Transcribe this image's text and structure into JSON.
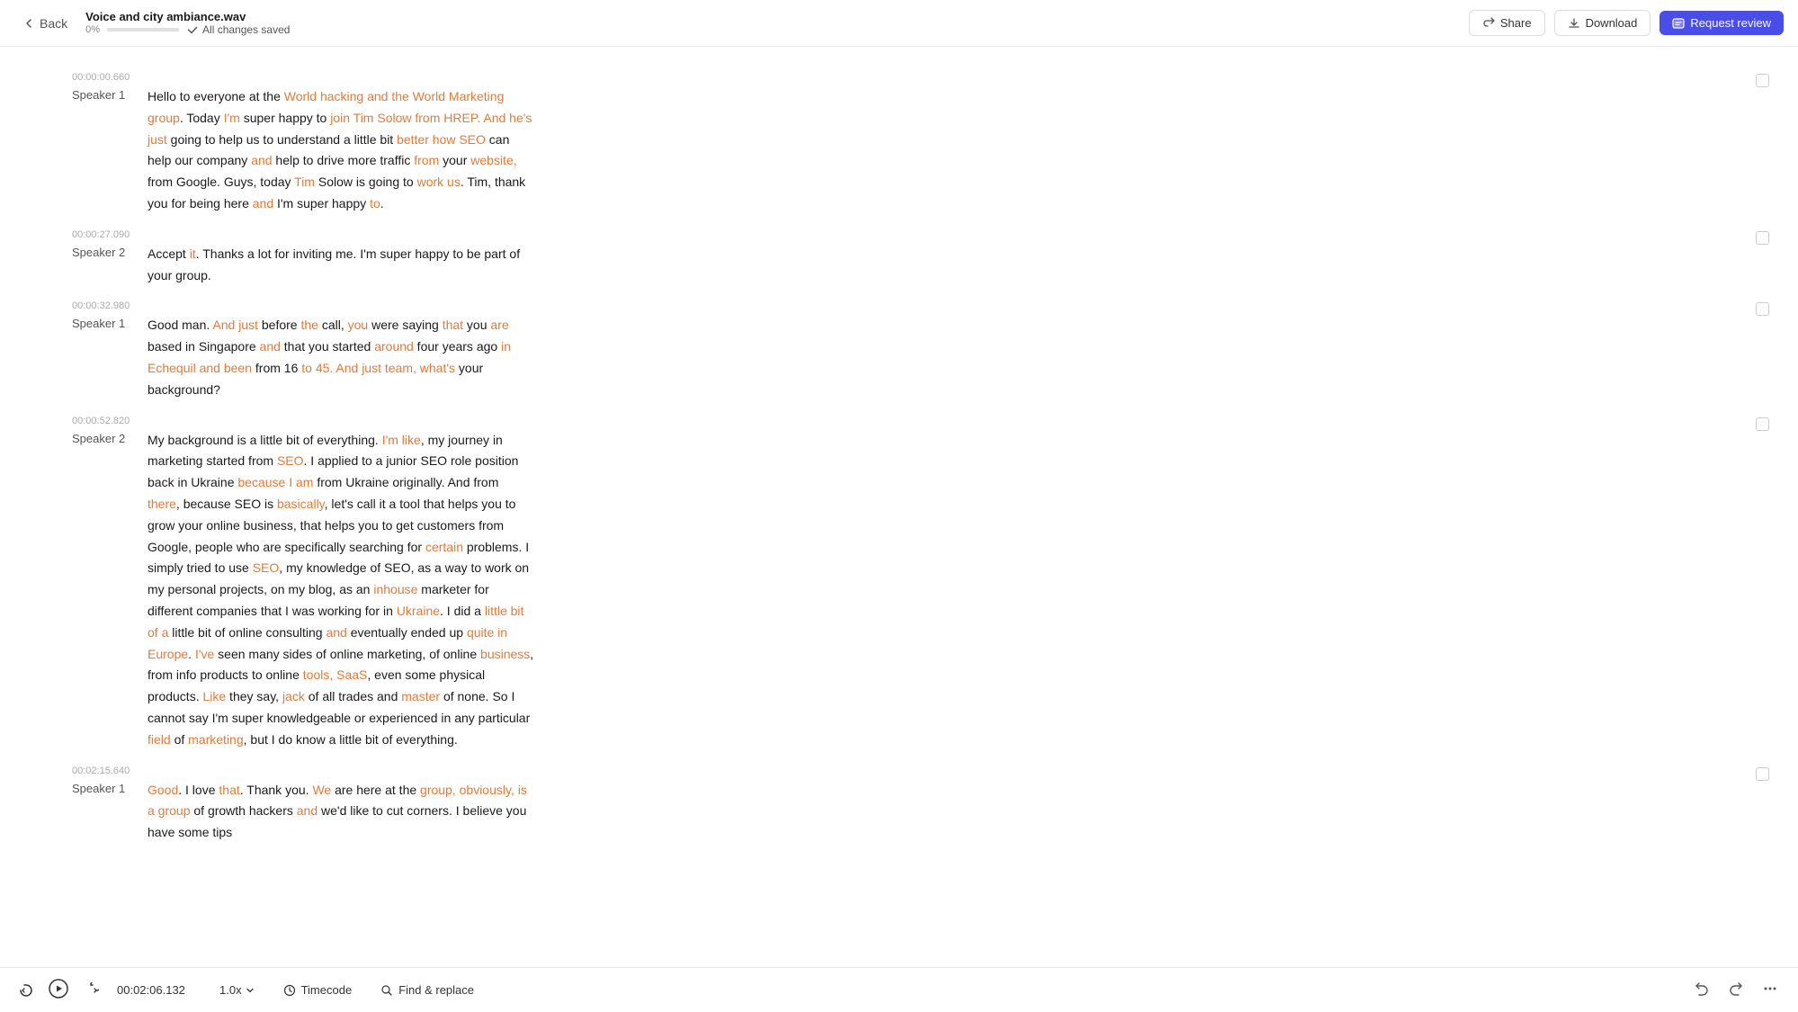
{
  "header": {
    "back_label": "Back",
    "file_name": "Voice and city ambiance.wav",
    "progress": "0%",
    "saved_status": "All changes saved",
    "share_label": "Share",
    "download_label": "Download",
    "request_review_label": "Request review"
  },
  "segments": [
    {
      "timestamp": "00:00:00.660",
      "speaker": "Speaker 1",
      "words": [
        {
          "text": "Hello to everyone at the ",
          "highlight": null
        },
        {
          "text": "World hacking and the World Marketing group",
          "highlight": "orange"
        },
        {
          "text": ". Today ",
          "highlight": null
        },
        {
          "text": "I'm",
          "highlight": "orange"
        },
        {
          "text": " super happy to ",
          "highlight": null
        },
        {
          "text": "join Tim Solow from HREP. And he's just",
          "highlight": "orange"
        },
        {
          "text": " going to help us to understand a little bit ",
          "highlight": null
        },
        {
          "text": "better how SEO",
          "highlight": "orange"
        },
        {
          "text": " can help our company ",
          "highlight": null
        },
        {
          "text": "and",
          "highlight": "orange"
        },
        {
          "text": " help to drive more traffic ",
          "highlight": null
        },
        {
          "text": "from",
          "highlight": "orange"
        },
        {
          "text": " your ",
          "highlight": null
        },
        {
          "text": "website,",
          "highlight": "orange"
        },
        {
          "text": " from Google. Guys, today ",
          "highlight": null
        },
        {
          "text": "Tim",
          "highlight": "orange"
        },
        {
          "text": " Solow is going to ",
          "highlight": null
        },
        {
          "text": "work us",
          "highlight": "orange"
        },
        {
          "text": ". Tim, thank you for being here ",
          "highlight": null
        },
        {
          "text": "and",
          "highlight": "orange"
        },
        {
          "text": " I'm super happy ",
          "highlight": null
        },
        {
          "text": "to",
          "highlight": "orange"
        },
        {
          "text": ".",
          "highlight": null
        }
      ]
    },
    {
      "timestamp": "00:00:27.090",
      "speaker": "Speaker 2",
      "words": [
        {
          "text": "Accept ",
          "highlight": null
        },
        {
          "text": "it",
          "highlight": "orange"
        },
        {
          "text": ". Thanks a lot for inviting me. I'm super happy to be part of your group.",
          "highlight": null
        }
      ]
    },
    {
      "timestamp": "00:00:32.980",
      "speaker": "Speaker 1",
      "words": [
        {
          "text": "Good man. ",
          "highlight": null
        },
        {
          "text": "And just",
          "highlight": "orange"
        },
        {
          "text": " before ",
          "highlight": null
        },
        {
          "text": "the",
          "highlight": "orange"
        },
        {
          "text": " call, ",
          "highlight": null
        },
        {
          "text": "you",
          "highlight": "orange"
        },
        {
          "text": " were saying ",
          "highlight": null
        },
        {
          "text": "that",
          "highlight": "orange"
        },
        {
          "text": " you ",
          "highlight": null
        },
        {
          "text": "are",
          "highlight": "orange"
        },
        {
          "text": " based in Singapore ",
          "highlight": null
        },
        {
          "text": "and",
          "highlight": "orange"
        },
        {
          "text": " that you started ",
          "highlight": null
        },
        {
          "text": "around",
          "highlight": "orange"
        },
        {
          "text": " four years ago ",
          "highlight": null
        },
        {
          "text": "in Echequil and been",
          "highlight": "orange"
        },
        {
          "text": " from 16 ",
          "highlight": null
        },
        {
          "text": "to 45. And just team, what's",
          "highlight": "orange"
        },
        {
          "text": " your background?",
          "highlight": null
        }
      ]
    },
    {
      "timestamp": "00:00:52.820",
      "speaker": "Speaker 2",
      "words": [
        {
          "text": "My background is a little bit of everything. ",
          "highlight": null
        },
        {
          "text": "I'm like",
          "highlight": "orange"
        },
        {
          "text": ", my journey in marketing started from ",
          "highlight": null
        },
        {
          "text": "SEO",
          "highlight": "orange"
        },
        {
          "text": ". I applied to a junior SEO role position back in Ukraine ",
          "highlight": null
        },
        {
          "text": "because I am",
          "highlight": "orange"
        },
        {
          "text": " from Ukraine originally. And from ",
          "highlight": null
        },
        {
          "text": "there",
          "highlight": "orange"
        },
        {
          "text": ", because SEO is ",
          "highlight": null
        },
        {
          "text": "basically",
          "highlight": "orange"
        },
        {
          "text": ", let's call it a tool that helps you to grow your online business, that helps you to get customers from Google, people who are specifically searching for ",
          "highlight": null
        },
        {
          "text": "certain",
          "highlight": "orange"
        },
        {
          "text": " problems. I simply tried to use ",
          "highlight": null
        },
        {
          "text": "SEO",
          "highlight": "orange"
        },
        {
          "text": ", my knowledge of SEO, as a way to work on my personal projects, on my blog, as an ",
          "highlight": null
        },
        {
          "text": "inhouse",
          "highlight": "orange"
        },
        {
          "text": " marketer for different companies that I was working for in ",
          "highlight": null
        },
        {
          "text": "Ukraine",
          "highlight": "orange"
        },
        {
          "text": ". I did a ",
          "highlight": null
        },
        {
          "text": "little bit of a",
          "highlight": "orange"
        },
        {
          "text": " little bit of online consulting ",
          "highlight": null
        },
        {
          "text": "and",
          "highlight": "orange"
        },
        {
          "text": " eventually ended up ",
          "highlight": null
        },
        {
          "text": "quite in Europe",
          "highlight": "orange"
        },
        {
          "text": ". ",
          "highlight": null
        },
        {
          "text": "I've",
          "highlight": "orange"
        },
        {
          "text": " seen many sides of online marketing, of online ",
          "highlight": null
        },
        {
          "text": "business",
          "highlight": "orange"
        },
        {
          "text": ", from info products to online ",
          "highlight": null
        },
        {
          "text": "tools, SaaS",
          "highlight": "orange"
        },
        {
          "text": ", even some physical products. ",
          "highlight": null
        },
        {
          "text": "Like",
          "highlight": "orange"
        },
        {
          "text": " they say, ",
          "highlight": null
        },
        {
          "text": "jack",
          "highlight": "orange"
        },
        {
          "text": " of all trades and ",
          "highlight": null
        },
        {
          "text": "master",
          "highlight": "orange"
        },
        {
          "text": " of none. So ",
          "highlight": null
        },
        {
          "text": "I",
          "highlight": null
        },
        {
          "text": " cannot say I'm super knowledgeable or experienced in any particular ",
          "highlight": null
        },
        {
          "text": "field",
          "highlight": "orange"
        },
        {
          "text": " of ",
          "highlight": null
        },
        {
          "text": "marketing",
          "highlight": "orange"
        },
        {
          "text": ", but I do know a little bit of everything.",
          "highlight": null
        }
      ]
    },
    {
      "timestamp": "00:02:15.640",
      "speaker": "Speaker 1",
      "words": [
        {
          "text": "Good",
          "highlight": "orange"
        },
        {
          "text": ". I love ",
          "highlight": null
        },
        {
          "text": "that",
          "highlight": "orange"
        },
        {
          "text": ". Thank ",
          "highlight": null
        },
        {
          "text": "you",
          "highlight": null
        },
        {
          "text": ". ",
          "highlight": null
        },
        {
          "text": "We",
          "highlight": "orange"
        },
        {
          "text": " are here at the ",
          "highlight": null
        },
        {
          "text": "group, obviously, is a group",
          "highlight": "orange"
        },
        {
          "text": " of growth hackers ",
          "highlight": null
        },
        {
          "text": "and",
          "highlight": "orange"
        },
        {
          "text": " we'd like to cut corners. I believe you have some tips",
          "highlight": null
        }
      ]
    }
  ],
  "bottom_bar": {
    "time": "00:02:06.132",
    "speed": "1.0x",
    "timecode_label": "Timecode",
    "find_replace_label": "Find & replace"
  }
}
